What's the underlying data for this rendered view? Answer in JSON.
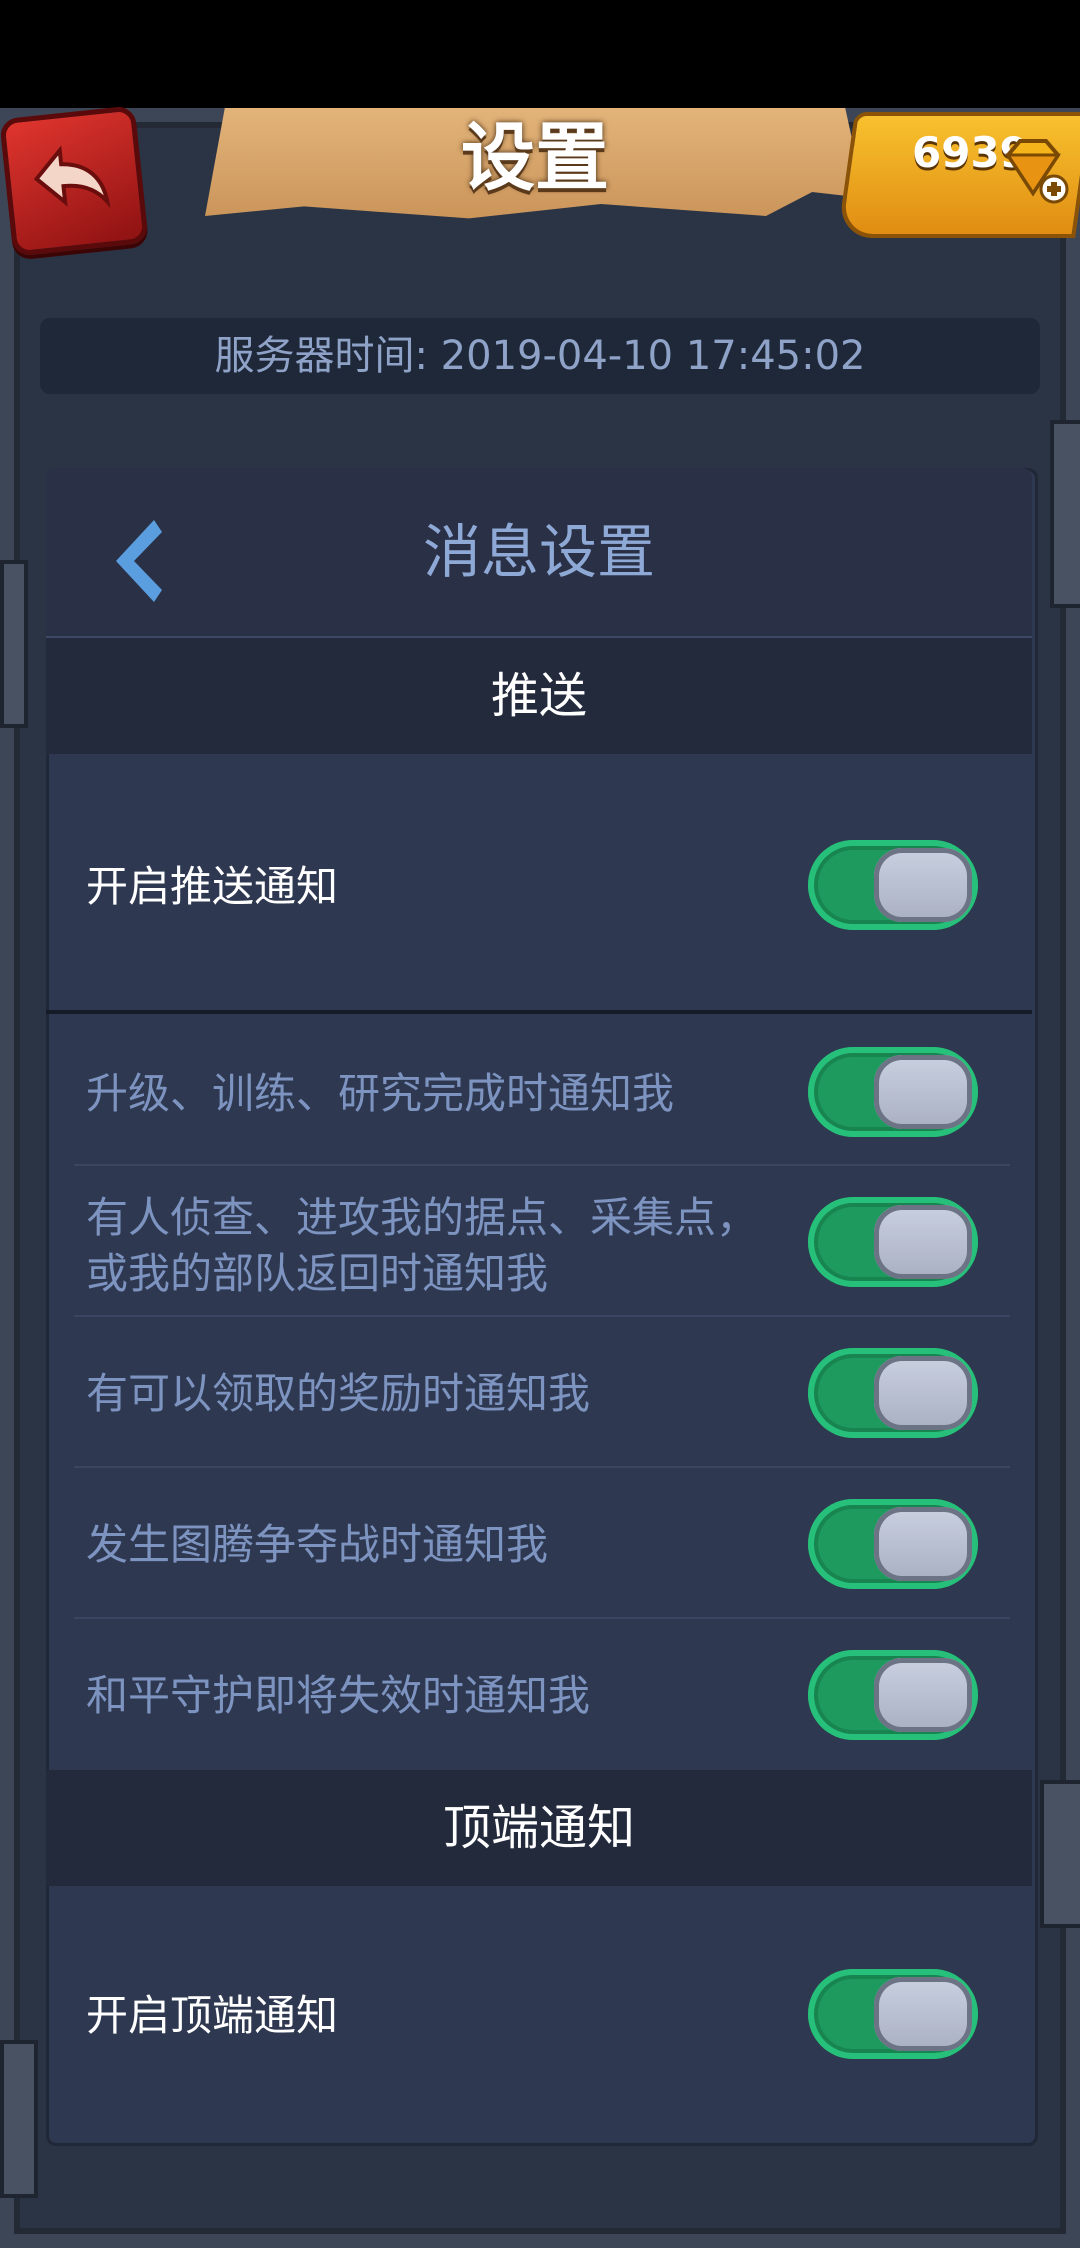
{
  "header": {
    "title": "设置",
    "gem_count": "6939",
    "back_icon": "back-arrow-icon",
    "gem_icon": "diamond-plus-icon"
  },
  "server_time": "服务器时间: 2019-04-10 17:45:02",
  "panel": {
    "title": "消息设置",
    "back_icon": "chevron-left-icon"
  },
  "sections": {
    "push": {
      "header": "推送",
      "master": {
        "label": "开启推送通知",
        "on": true
      },
      "items": [
        {
          "label": "升级、训练、研究完成时通知我",
          "on": true
        },
        {
          "label": "有人侦查、进攻我的据点、采集点，",
          "label2": "或我的部队返回时通知我",
          "on": true
        },
        {
          "label": "有可以领取的奖励时通知我",
          "on": true
        },
        {
          "label": "发生图腾争夺战时通知我",
          "on": true
        },
        {
          "label": "和平守护即将失效时通知我",
          "on": true
        }
      ]
    },
    "top": {
      "header": "顶端通知",
      "master": {
        "label": "开启顶端通知",
        "on": true
      }
    }
  },
  "colors": {
    "toggle_on": "#1f9a5f",
    "panel_bg": "#2e3850",
    "label_muted": "#7d93c0",
    "title_blue": "#8fa9d6"
  }
}
